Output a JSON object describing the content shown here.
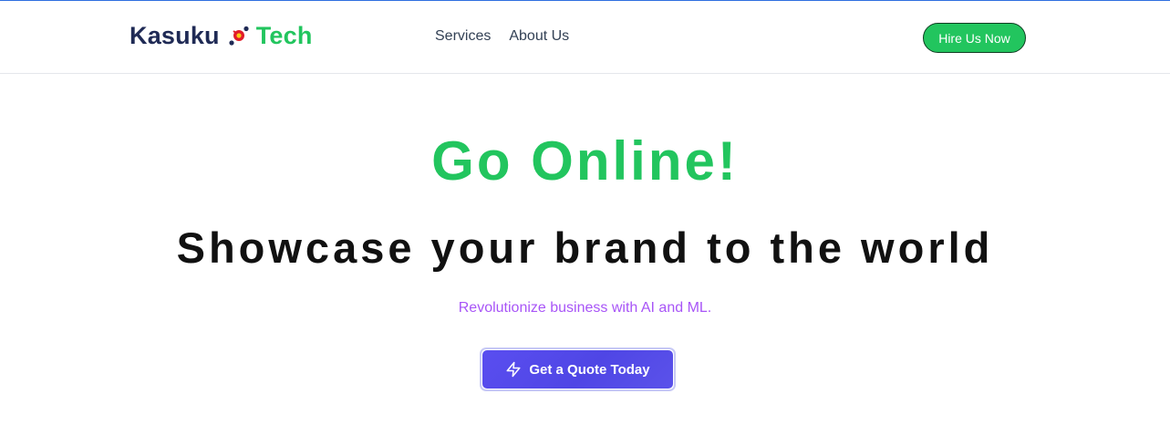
{
  "header": {
    "logo": {
      "part1": "Kasuku",
      "part2": "Tech",
      "icon": "parrot-logo-icon"
    },
    "nav": [
      {
        "label": "Services"
      },
      {
        "label": "About Us"
      }
    ],
    "cta_label": "Hire Us Now"
  },
  "hero": {
    "title": "Go Online!",
    "subtitle": "Showcase your brand to the world",
    "tagline": "Revolutionize business with AI and ML.",
    "button_label": "Get a Quote Today",
    "button_icon": "lightning-icon"
  },
  "colors": {
    "brand_green": "#22c55e",
    "brand_navy": "#1f2a55",
    "accent_purple": "#a855f7",
    "button_indigo": "#4f46e5"
  }
}
